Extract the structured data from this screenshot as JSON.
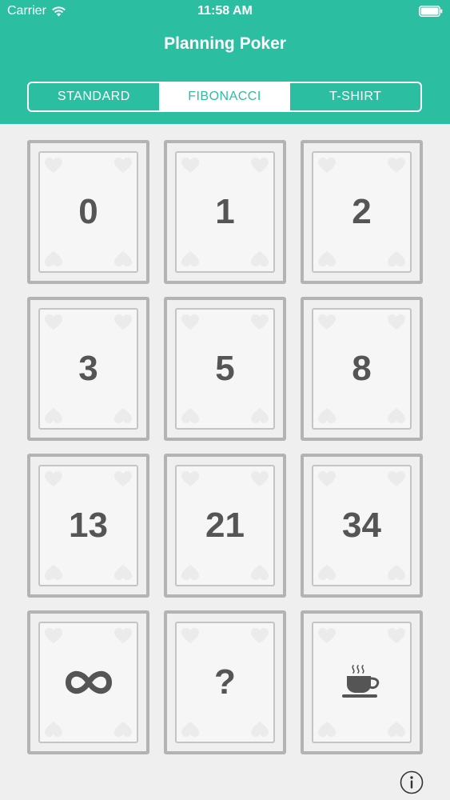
{
  "status_bar": {
    "carrier": "Carrier",
    "time": "11:58 AM"
  },
  "header": {
    "title": "Planning Poker"
  },
  "segments": [
    {
      "label": "STANDARD",
      "selected": false
    },
    {
      "label": "FIBONACCI",
      "selected": true
    },
    {
      "label": "T-SHIRT",
      "selected": false
    }
  ],
  "cards": [
    {
      "value": "0"
    },
    {
      "value": "1"
    },
    {
      "value": "2"
    },
    {
      "value": "3"
    },
    {
      "value": "5"
    },
    {
      "value": "8"
    },
    {
      "value": "13"
    },
    {
      "value": "21"
    },
    {
      "value": "34"
    },
    {
      "icon": "infinity-icon"
    },
    {
      "value": "?"
    },
    {
      "icon": "coffee-cup-icon"
    }
  ],
  "colors": {
    "accent": "#2bbea0",
    "card_text": "#555555",
    "card_border": "#b3b3b3",
    "background": "#efefef"
  },
  "icons": {
    "info": "info-icon"
  }
}
